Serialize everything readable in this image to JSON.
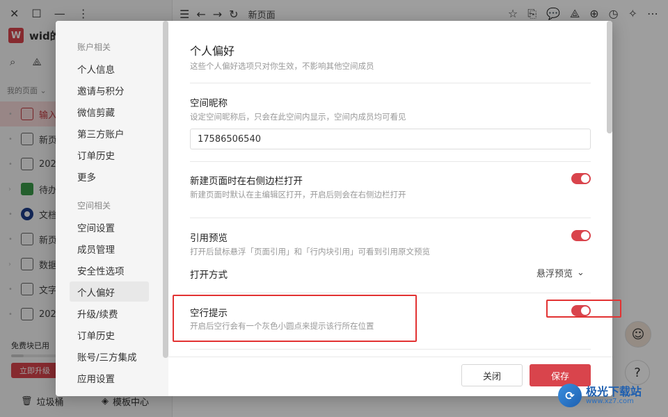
{
  "app": {
    "workspace_logo": "W",
    "workspace_name": "wid的",
    "page_title": "新页面",
    "my_pages_label": "我的页面",
    "pages": [
      {
        "label": "输入",
        "icon": "page-icon",
        "active": true
      },
      {
        "label": "新页",
        "icon": "page-icon"
      },
      {
        "label": "202",
        "icon": "page-icon"
      },
      {
        "label": "待办",
        "icon": "check-icon"
      },
      {
        "label": "文档",
        "icon": "target-icon"
      },
      {
        "label": "新页",
        "icon": "page-icon"
      },
      {
        "label": "数据",
        "icon": "table-icon"
      },
      {
        "label": "文字",
        "icon": "page-icon"
      },
      {
        "label": "202",
        "icon": "page-icon"
      }
    ],
    "quota_label": "免费块已用",
    "quota_fraction": 0.18,
    "upgrade_label": "立即升级",
    "trash_label": "垃圾桶",
    "templates_label": "模板中心"
  },
  "nav": {
    "group_account": "账户相关",
    "account_items": [
      "个人信息",
      "邀请与积分",
      "微信剪藏",
      "第三方账户",
      "订单历史",
      "更多"
    ],
    "group_space": "空间相关",
    "space_items": [
      "空间设置",
      "成员管理",
      "安全性选项",
      "个人偏好",
      "升级/续费",
      "订单历史",
      "账号/三方集成",
      "应用设置"
    ],
    "active_item": "个人偏好"
  },
  "prefs": {
    "title": "个人偏好",
    "desc": "这些个人偏好选项只对你生效，不影响其他空间成员",
    "nickname_title": "空间昵称",
    "nickname_desc": "设定空间昵称后，只会在此空间内显示，空间内成员均可看见",
    "nickname_value": "17586506540",
    "sidebar_open_title": "新建页面时在右侧边栏打开",
    "sidebar_open_desc": "新建页面时默认在主编辑区打开，开启后则会在右侧边栏打开",
    "sidebar_open_on": true,
    "ref_preview_title": "引用预览",
    "ref_preview_desc": "打开后鼠标悬浮「页面引用」和「行内块引用」可看到引用原文预览",
    "ref_preview_on": true,
    "open_mode_label": "打开方式",
    "open_mode_value": "悬浮预览",
    "empty_line_title": "空行提示",
    "empty_line_desc": "开启后空行会有一个灰色小圆点来提示该行所在位置",
    "empty_line_on": true
  },
  "footer": {
    "close_label": "关闭",
    "save_label": "保存"
  },
  "watermark": {
    "name": "极光下载站",
    "url": "www.xz7.com"
  },
  "colors": {
    "accent": "#d9444c",
    "highlight": "#e23232"
  }
}
